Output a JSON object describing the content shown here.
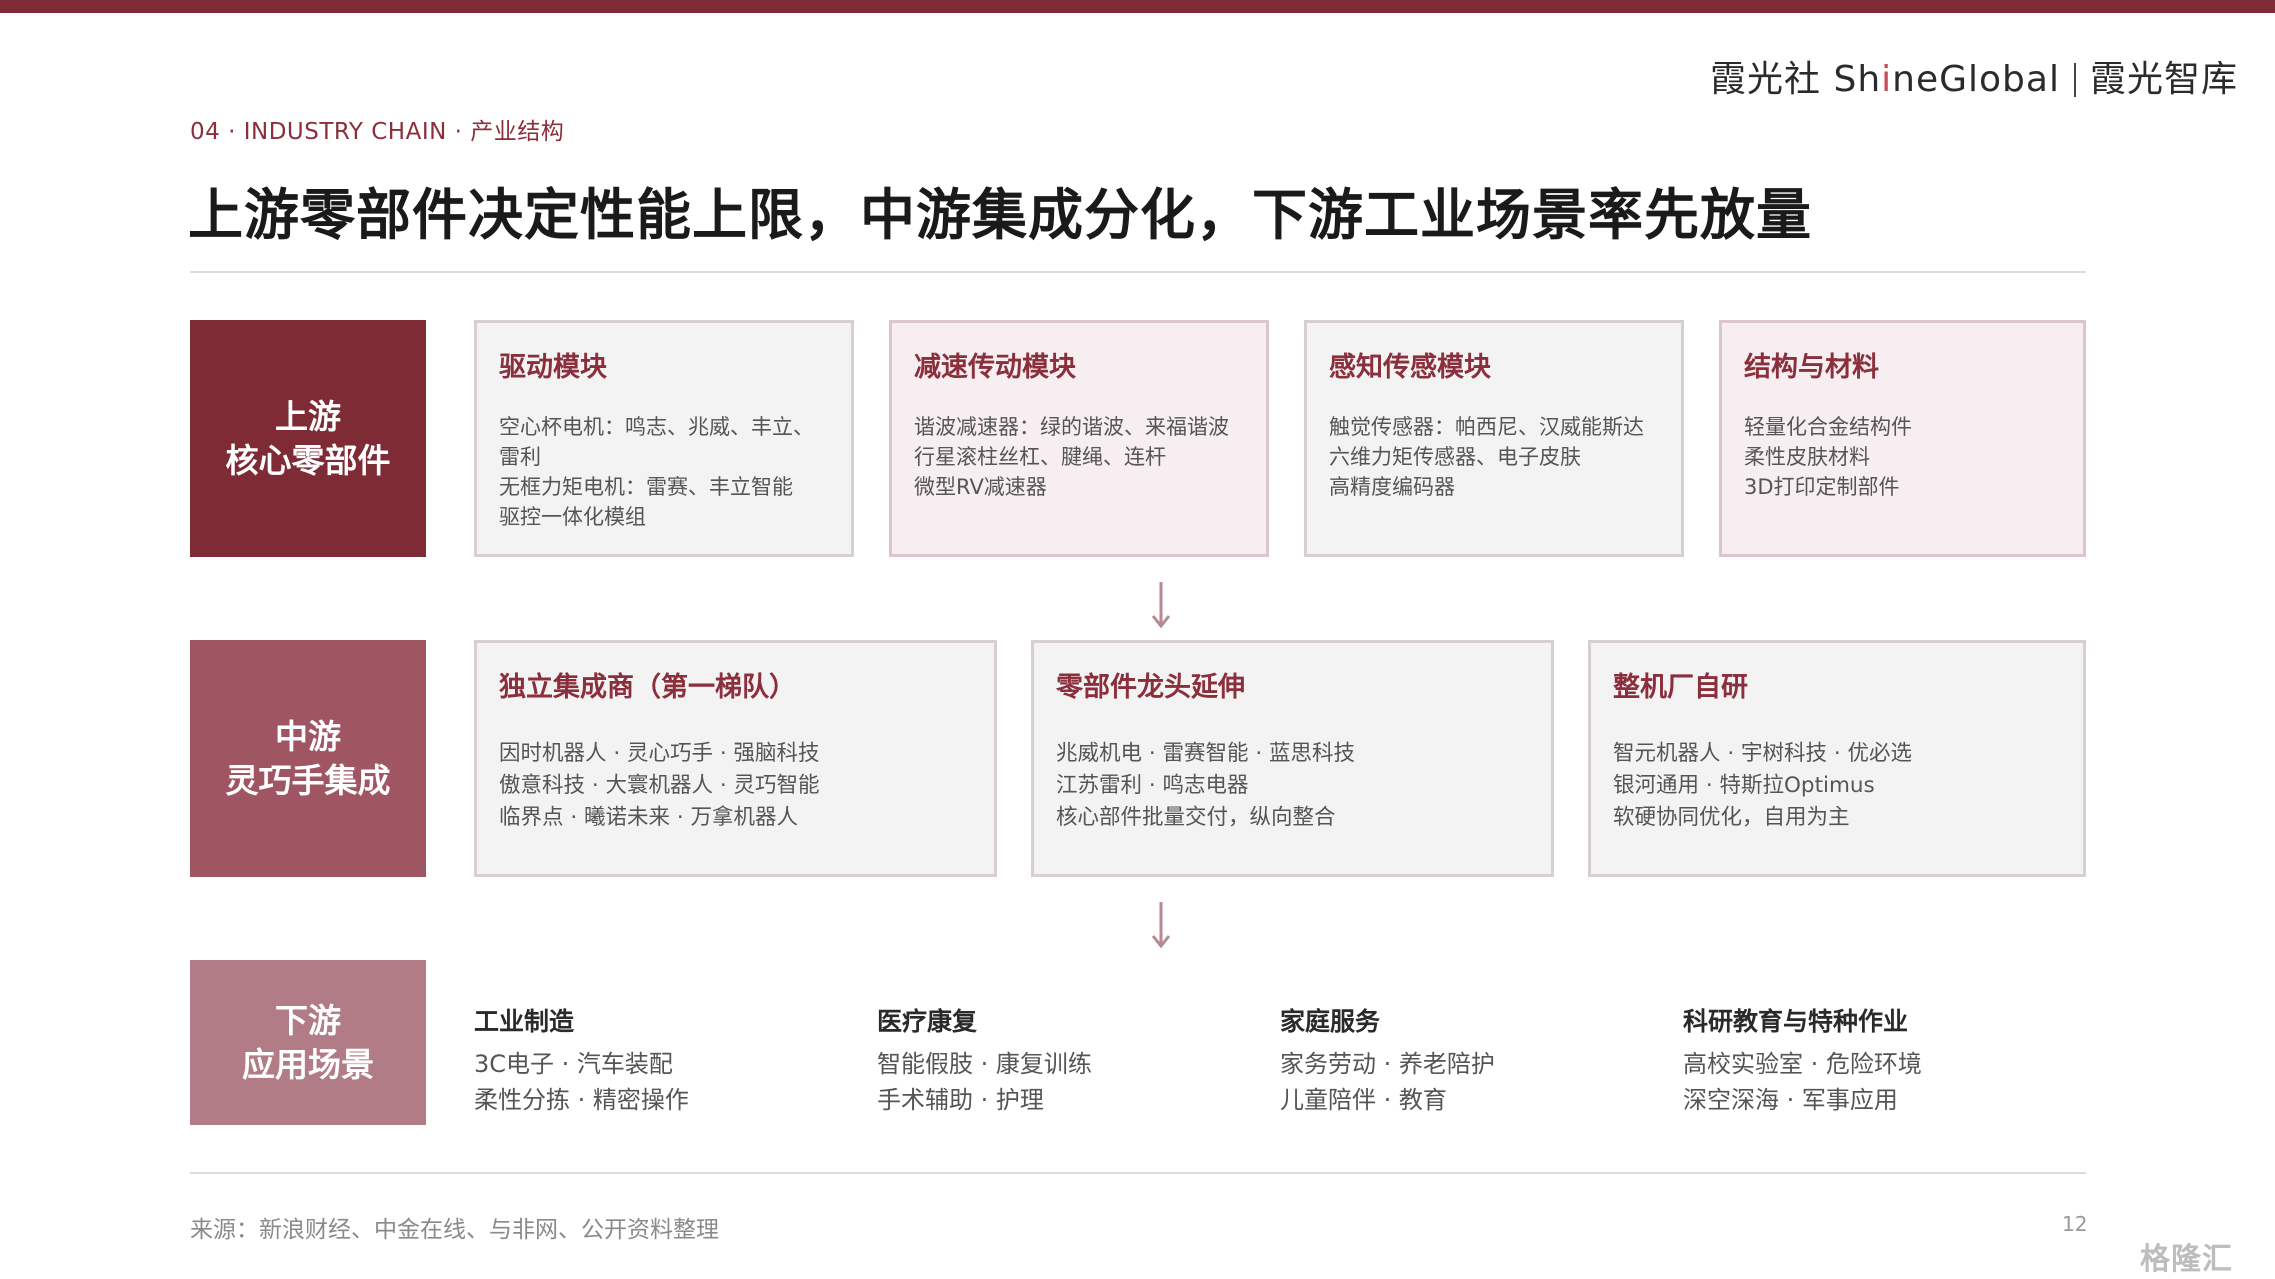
{
  "brand": {
    "part1": "霞光社 Sh",
    "part_i": "i",
    "part2": "neGlobal",
    "part3": "霞光智库"
  },
  "section_label": "04 · INDUSTRY CHAIN · 产业结构",
  "title": "上游零部件决定性能上限，中游集成分化，下游工业场景率先放量",
  "upstream": {
    "label": [
      "上游",
      "核心零部件"
    ],
    "color": "#7e2b36",
    "cards": [
      {
        "title": "驱动模块",
        "lines": [
          "空心杯电机：鸣志、兆威、丰立、",
          "雷利",
          "无框力矩电机：雷赛、丰立智能",
          "驱控一体化模组"
        ]
      },
      {
        "title": "减速传动模块",
        "lines": [
          "谐波减速器：绿的谐波、来福谐波",
          "行星滚柱丝杠、腱绳、连杆",
          "微型RV减速器"
        ]
      },
      {
        "title": "感知传感模块",
        "lines": [
          "触觉传感器：帕西尼、汉威能斯达",
          "六维力矩传感器、电子皮肤",
          "高精度编码器"
        ]
      },
      {
        "title": "结构与材料",
        "lines": [
          "轻量化合金结构件",
          "柔性皮肤材料",
          "3D打印定制部件"
        ]
      }
    ]
  },
  "midstream": {
    "label": [
      "中游",
      "灵巧手集成"
    ],
    "color": "#a05563",
    "cards": [
      {
        "title": "独立集成商（第一梯队）",
        "lines": [
          "因时机器人 · 灵心巧手 · 强脑科技",
          "傲意科技 · 大寰机器人 · 灵巧智能",
          "临界点 · 曦诺未来 · 万拿机器人"
        ]
      },
      {
        "title": "零部件龙头延伸",
        "lines": [
          "兆威机电 · 雷赛智能 · 蓝思科技",
          "江苏雷利 · 鸣志电器",
          "核心部件批量交付，纵向整合"
        ]
      },
      {
        "title": "整机厂自研",
        "lines": [
          "智元机器人 · 宇树科技 · 优必选",
          "银河通用 · 特斯拉Optimus",
          "软硬协同优化，自用为主"
        ]
      }
    ]
  },
  "downstream": {
    "label": [
      "下游",
      "应用场景"
    ],
    "color": "#b17c86",
    "apps": [
      {
        "title": "工业制造",
        "lines": [
          "3C电子 · 汽车装配",
          "柔性分拣 · 精密操作"
        ]
      },
      {
        "title": "医疗康复",
        "lines": [
          "智能假肢 · 康复训练",
          "手术辅助 · 护理"
        ]
      },
      {
        "title": "家庭服务",
        "lines": [
          "家务劳动 · 养老陪护",
          "儿童陪伴 · 教育"
        ]
      },
      {
        "title": "科研教育与特种作业",
        "lines": [
          "高校实验室 · 危险环境",
          "深空深海 · 军事应用"
        ]
      }
    ]
  },
  "footer": {
    "source": "来源：新浪财经、中金在线、与非网、公开资料整理",
    "page": "12"
  },
  "watermark": "格隆汇",
  "colors": {
    "accent": "#7e2b36",
    "upstream_card_bg": "#f4f1f2",
    "midstream_card_bg": "#f3f3f4",
    "title_red": "#8a2f3b"
  }
}
